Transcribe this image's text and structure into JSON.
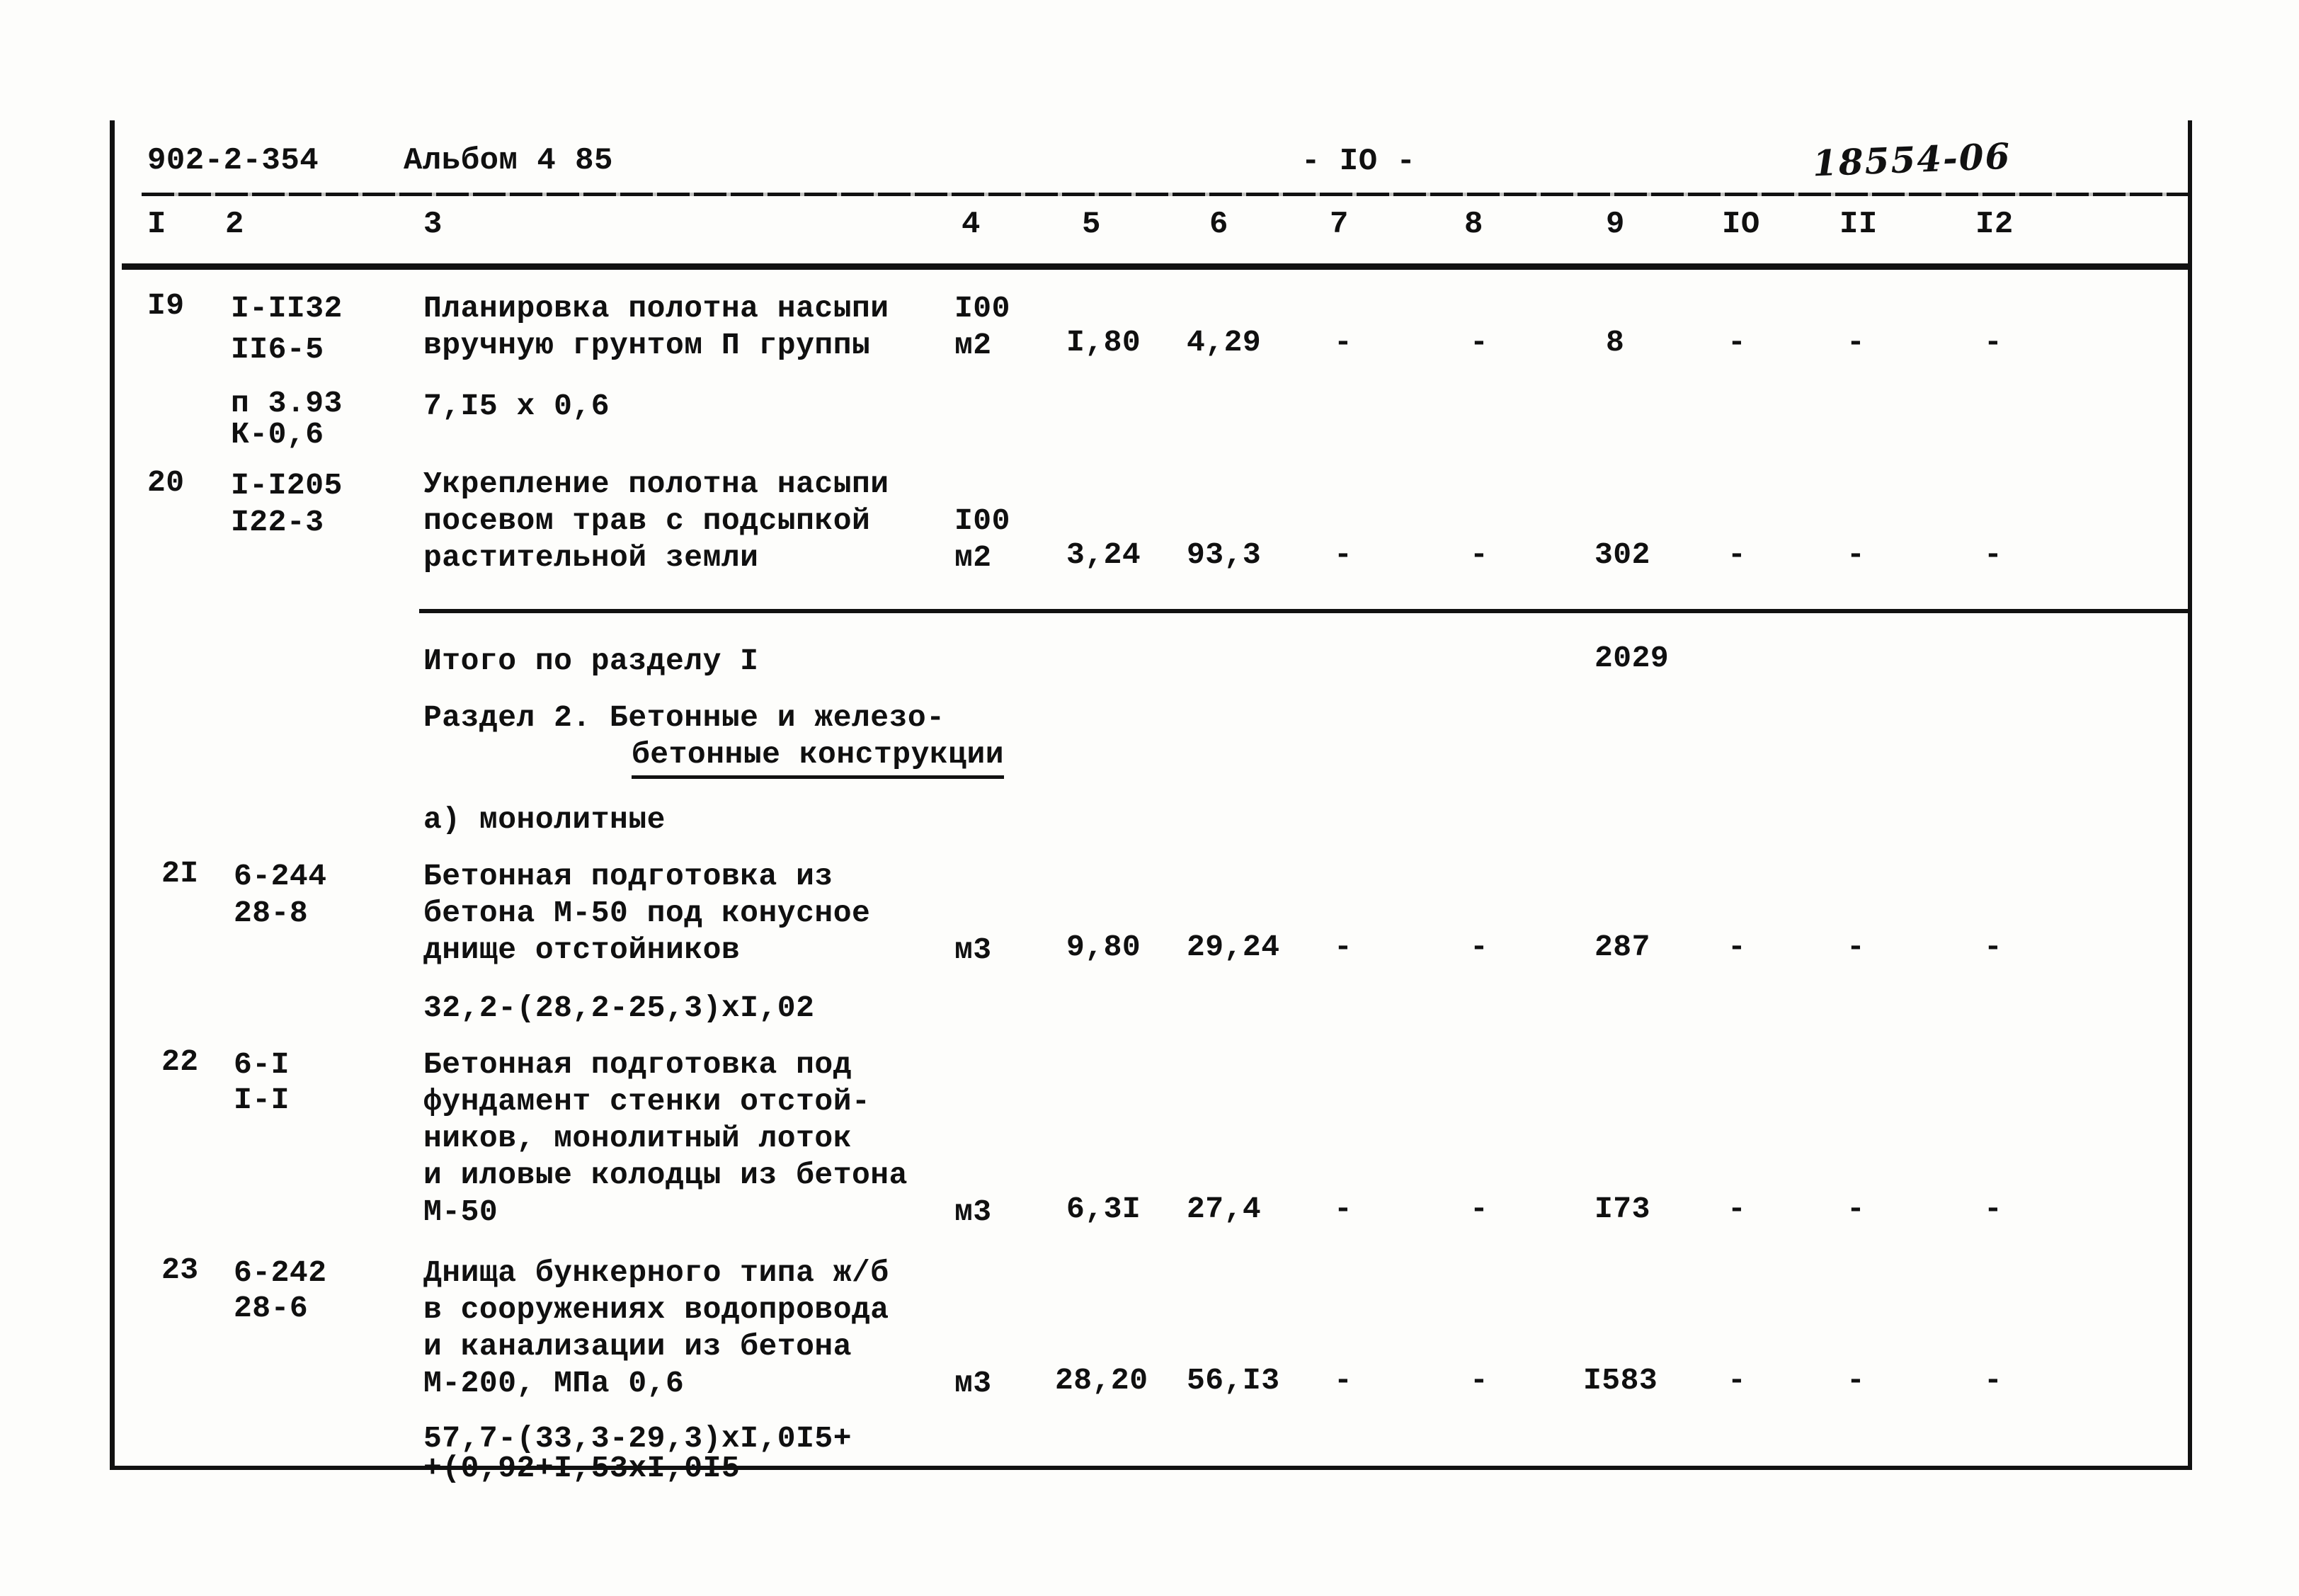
{
  "document": {
    "project_code": "902-2-354",
    "album": "Альбом 4 85",
    "page_marker": "- IO -",
    "archive_stamp": "18554-06"
  },
  "table": {
    "column_numbers": [
      "I",
      "2",
      "3",
      "4",
      "5",
      "6",
      "7",
      "8",
      "9",
      "IO",
      "II",
      "I2"
    ],
    "rows": [
      {
        "no": "I9",
        "codes": [
          "I-II32",
          "II6-5",
          "",
          "п 3.93",
          "К-0,6"
        ],
        "description": [
          "Планировка полотна насыпи",
          "вручную грунтом П группы"
        ],
        "formula": [
          "7,I5 х 0,6"
        ],
        "unit": [
          "I00",
          "м2"
        ],
        "c5": "I,80",
        "c6": "4,29",
        "c7": "-",
        "c8": "-",
        "c9": "8",
        "c10": "-",
        "c11": "-",
        "c12": "-"
      },
      {
        "no": "20",
        "codes": [
          "I-I205",
          "I22-3"
        ],
        "description": [
          "Укрепление полотна насыпи",
          "посевом трав с подсыпкой",
          "растительной земли"
        ],
        "formula": [],
        "unit": [
          "I00",
          "м2"
        ],
        "c5": "3,24",
        "c6": "93,3",
        "c7": "-",
        "c8": "-",
        "c9": "302",
        "c10": "-",
        "c11": "-",
        "c12": "-"
      },
      {
        "no": "2I",
        "codes": [
          "6-244",
          "28-8"
        ],
        "description": [
          "Бетонная подготовка из",
          "бетона М-50 под конусное",
          "днище отстойников"
        ],
        "formula": [
          "32,2-(28,2-25,3)хI,02"
        ],
        "unit": [
          "м3"
        ],
        "c5": "9,80",
        "c6": "29,24",
        "c7": "-",
        "c8": "-",
        "c9": "287",
        "c10": "-",
        "c11": "-",
        "c12": "-"
      },
      {
        "no": "22",
        "codes": [
          "6-I",
          "I-I"
        ],
        "description": [
          "Бетонная подготовка под",
          "фундамент стенки отстой-",
          "ников, монолитный лоток",
          "и иловые колодцы из бетона",
          "М-50"
        ],
        "formula": [],
        "unit": [
          "м3"
        ],
        "c5": "6,3I",
        "c6": "27,4",
        "c7": "-",
        "c8": "-",
        "c9": "I73",
        "c10": "-",
        "c11": "-",
        "c12": "-"
      },
      {
        "no": "23",
        "codes": [
          "6-242",
          "28-6"
        ],
        "description": [
          "Днища бункерного типа ж/б",
          "в сооружениях водопровода",
          "и канализации из бетона",
          "М-200, МПа 0,6"
        ],
        "formula": [
          "57,7-(33,3-29,3)хI,0I5+",
          "+(0,92+I,53хI,0I5"
        ],
        "unit": [
          "м3"
        ],
        "c5": "28,20",
        "c6": "56,I3",
        "c7": "-",
        "c8": "-",
        "c9": "I583",
        "c10": "-",
        "c11": "-",
        "c12": "-"
      }
    ],
    "section_summary": {
      "total_label": "Итого по разделу I",
      "total_value": "2029",
      "section_title_line1": "Раздел 2. Бетонные и железо-",
      "section_title_line2": "бетонные конструкции",
      "subsection": "а) монолитные"
    }
  }
}
